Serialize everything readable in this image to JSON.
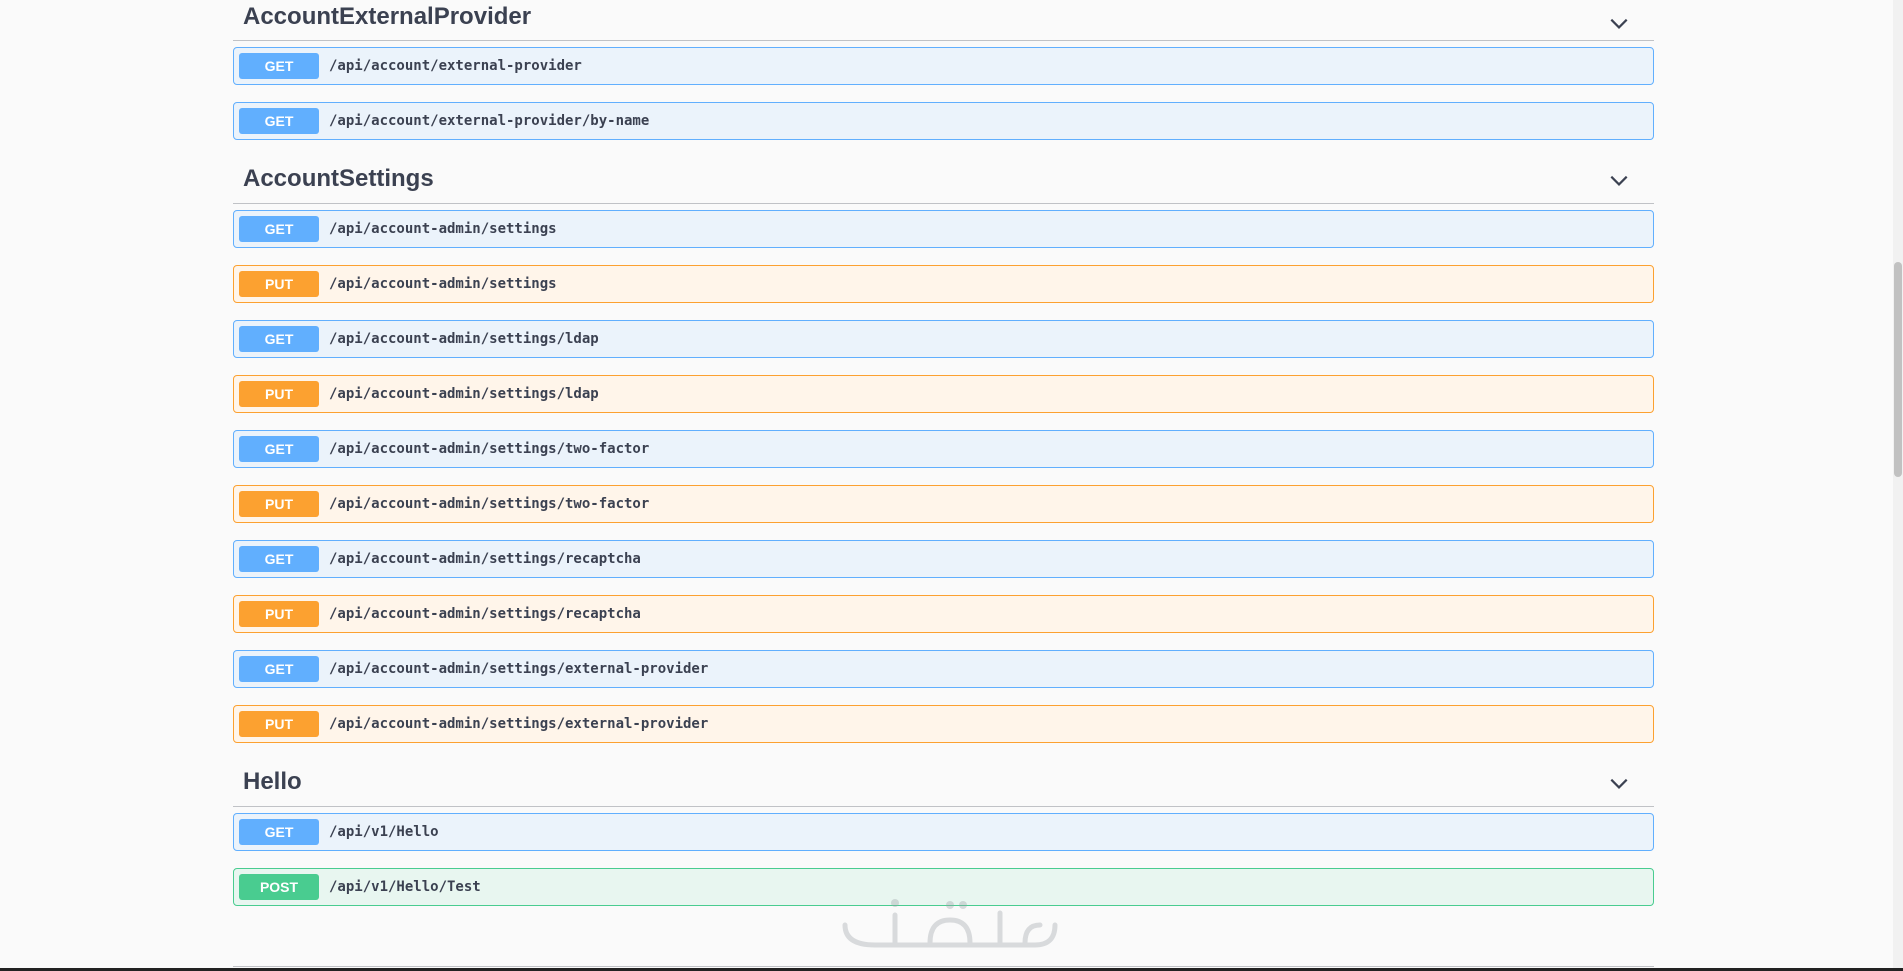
{
  "sections": [
    {
      "title": "AccountExternalProvider",
      "operations": [
        {
          "method": "GET",
          "path": "/api/account/external-provider"
        },
        {
          "method": "GET",
          "path": "/api/account/external-provider/by-name"
        }
      ]
    },
    {
      "title": "AccountSettings",
      "operations": [
        {
          "method": "GET",
          "path": "/api/account-admin/settings"
        },
        {
          "method": "PUT",
          "path": "/api/account-admin/settings"
        },
        {
          "method": "GET",
          "path": "/api/account-admin/settings/ldap"
        },
        {
          "method": "PUT",
          "path": "/api/account-admin/settings/ldap"
        },
        {
          "method": "GET",
          "path": "/api/account-admin/settings/two-factor"
        },
        {
          "method": "PUT",
          "path": "/api/account-admin/settings/two-factor"
        },
        {
          "method": "GET",
          "path": "/api/account-admin/settings/recaptcha"
        },
        {
          "method": "PUT",
          "path": "/api/account-admin/settings/recaptcha"
        },
        {
          "method": "GET",
          "path": "/api/account-admin/settings/external-provider"
        },
        {
          "method": "PUT",
          "path": "/api/account-admin/settings/external-provider"
        }
      ]
    },
    {
      "title": "Hello",
      "operations": [
        {
          "method": "GET",
          "path": "/api/v1/Hello"
        },
        {
          "method": "POST",
          "path": "/api/v1/Hello/Test"
        }
      ]
    }
  ],
  "icons": {
    "section_toggle": "chevron-down-icon",
    "watermark": "watermark-logo"
  },
  "colors": {
    "get": "#61affe",
    "put": "#fca130",
    "post": "#49cc90",
    "text": "#3b4151"
  }
}
